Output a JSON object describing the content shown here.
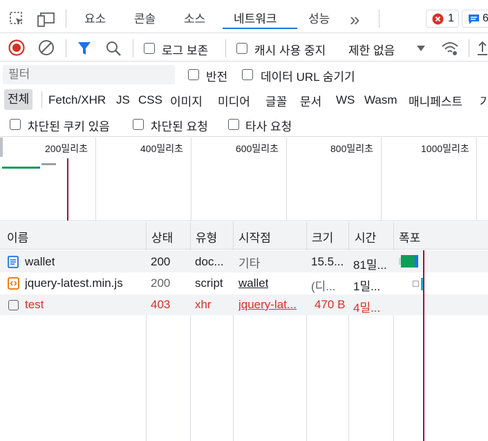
{
  "topbar": {
    "tabs": [
      "요소",
      "콘솔",
      "소스",
      "네트워크",
      "성능"
    ],
    "more": "»",
    "error_count": "1",
    "message_count": "6"
  },
  "toolbar": {
    "preserve_log": "로그 보존",
    "disable_cache": "캐시 사용 중지",
    "throttling": "제한 없음"
  },
  "filterbar": {
    "placeholder": "필터",
    "invert": "반전",
    "hide_data_urls": "데이터 URL 숨기기"
  },
  "types": [
    "전체",
    "Fetch/XHR",
    "JS",
    "CSS",
    "이미지",
    "미디어",
    "글꼴",
    "문서",
    "WS",
    "Wasm",
    "매니페스트",
    "기"
  ],
  "blocked": {
    "cookies": "차단된 쿠키 있음",
    "requests": "차단된 요청",
    "third_party": "타사 요청"
  },
  "timeline": {
    "ticks": [
      "200밀리초",
      "400밀리초",
      "600밀리초",
      "800밀리초",
      "1000밀리초"
    ]
  },
  "table": {
    "headers": [
      "이름",
      "상태",
      "유형",
      "시작점",
      "크기",
      "시간",
      "폭포"
    ],
    "rows": [
      {
        "name": "wallet",
        "status": "200",
        "type": "doc...",
        "initiator": "기타",
        "size": "15.5...",
        "time": "81밀...",
        "icon": "document-icon",
        "color": "#202124"
      },
      {
        "name": "jquery-latest.min.js",
        "status": "200",
        "type": "script",
        "initiator": "wallet",
        "size": "(디...",
        "time": "1밀...",
        "icon": "script-icon",
        "color": "#202124"
      },
      {
        "name": "test",
        "status": "403",
        "type": "xhr",
        "initiator": "jquery-lat...",
        "size": "470 B",
        "time": "4밀...",
        "icon": "xhr-icon",
        "color": "#d93025"
      }
    ]
  },
  "colors": {
    "accent": "#1a73e8",
    "error": "#d93025",
    "waterfall_green": "#0f9d58",
    "waterfall_blue": "#1a73e8",
    "load_line": "#a50e3a"
  }
}
